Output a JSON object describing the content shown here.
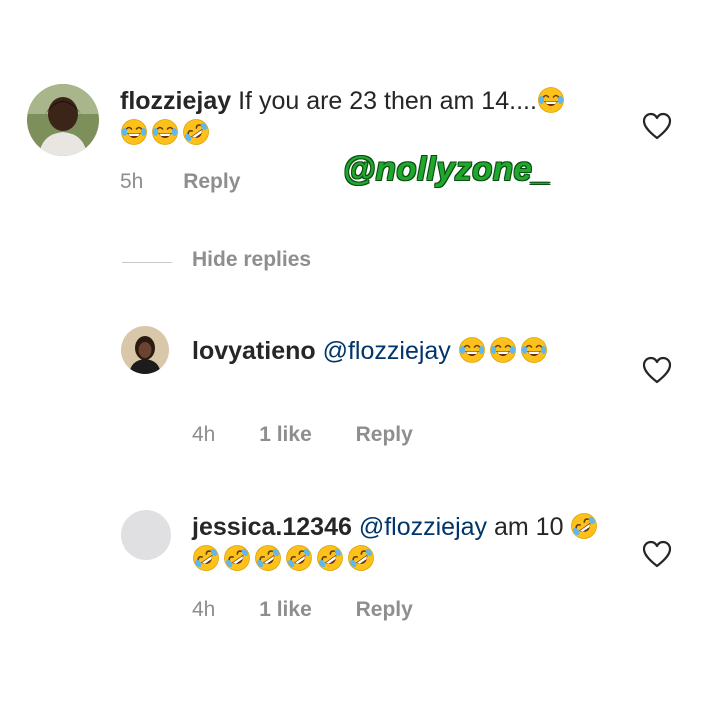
{
  "watermark": "@nollyzone_",
  "hide_replies_label": "Hide replies",
  "comments": [
    {
      "username": "flozziejay",
      "text": "If you are 23 then am 14....",
      "emojis": [
        "joy",
        "joy",
        "joy",
        "rofl"
      ],
      "time": "5h",
      "likes": "",
      "reply_label": "Reply",
      "avatar": "user-photo"
    },
    {
      "username": "lovyatieno",
      "mention": "@flozziejay",
      "text": "",
      "emojis": [
        "joy",
        "joy",
        "joy"
      ],
      "time": "4h",
      "likes": "1 like",
      "reply_label": "Reply",
      "avatar": "user-photo"
    },
    {
      "username": "jessica.12346",
      "mention": "@flozziejay",
      "text": "am 10",
      "emojis": [
        "rofl",
        "rofl",
        "rofl",
        "rofl",
        "rofl",
        "rofl",
        "rofl"
      ],
      "time": "4h",
      "likes": "1 like",
      "reply_label": "Reply",
      "avatar": "default-placeholder"
    }
  ],
  "colors": {
    "username": "#262626",
    "mention": "#003569",
    "meta": "#8e8e8e",
    "watermark": "#1fa82c"
  }
}
